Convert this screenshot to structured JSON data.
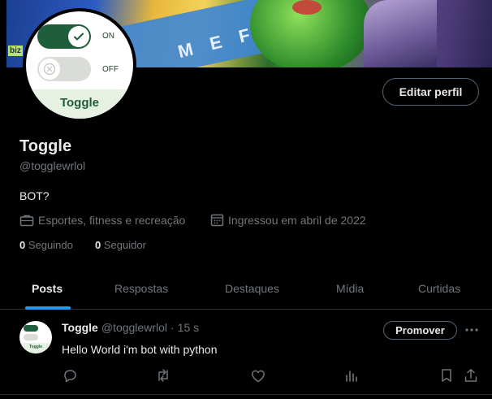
{
  "banner": {
    "letters": "MEF",
    "tag": "biz"
  },
  "avatar": {
    "on_label": "ON",
    "off_label": "OFF",
    "name": "Toggle"
  },
  "profile": {
    "edit_button": "Editar perfil",
    "name": "Toggle",
    "handle": "@togglewrlol",
    "bio": "BOT?",
    "category": "Esportes, fitness e recreação",
    "joined": "Ingressou em abril de 2022",
    "following_count": "0",
    "following_label": "Seguindo",
    "followers_count": "0",
    "followers_label": "Seguidor"
  },
  "tabs": [
    {
      "label": "Posts",
      "active": true
    },
    {
      "label": "Respostas",
      "active": false
    },
    {
      "label": "Destaques",
      "active": false
    },
    {
      "label": "Mídia",
      "active": false
    },
    {
      "label": "Curtidas",
      "active": false
    }
  ],
  "post": {
    "author_name": "Toggle",
    "author_handle": "@togglewrlol",
    "separator": "·",
    "time": "15 s",
    "text": "Hello World i'm bot with python",
    "promote_button": "Promover",
    "avatar_label": "Toggle"
  },
  "colors": {
    "accent": "#1d9bf0",
    "background": "#000000",
    "secondary_text": "#71767b",
    "primary_text": "#e7e9ea",
    "toggle_green": "#1f5e3a"
  },
  "icons": {
    "category": "briefcase-icon",
    "joined": "calendar-icon",
    "reply": "reply-icon",
    "retweet": "retweet-icon",
    "like": "heart-icon",
    "views": "views-icon",
    "bookmark": "bookmark-icon",
    "share": "share-icon",
    "more": "more-icon"
  }
}
